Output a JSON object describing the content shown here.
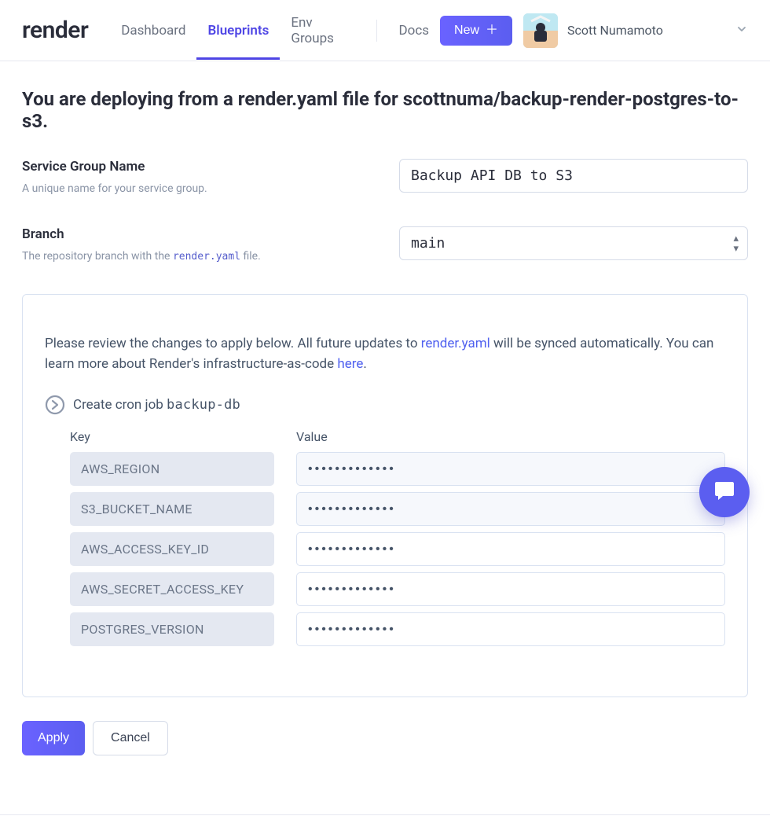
{
  "brand": {
    "name": "render"
  },
  "nav": {
    "tabs": [
      {
        "label": "Dashboard"
      },
      {
        "label": "Blueprints",
        "active": true
      },
      {
        "label": "Env Groups"
      }
    ],
    "docs_label": "Docs",
    "new_button_label": "New"
  },
  "user": {
    "name": "Scott Numamoto"
  },
  "page": {
    "title": "You are deploying from a render.yaml file for scottnuma/backup-render-postgres-to-s3."
  },
  "form": {
    "service_group": {
      "label": "Service Group Name",
      "help": "A unique name for your service group.",
      "value": "Backup API DB to S3"
    },
    "branch": {
      "label": "Branch",
      "help_pre": "The repository branch with the ",
      "help_code": "render.yaml",
      "help_post": " file.",
      "value": "main"
    }
  },
  "panel": {
    "text_part1": "Please review the changes to apply below. All future updates to ",
    "link1": "render.yaml",
    "text_part2": " will be synced automatically. You can learn more about Render's infrastructure-as-code ",
    "link2": "here",
    "text_part3": ".",
    "cron": {
      "prefix": "Create cron job ",
      "name": "backup-db"
    },
    "headers": {
      "key": "Key",
      "value": "Value"
    },
    "env_rows": [
      {
        "key": "AWS_REGION",
        "value": "•••••••••••••"
      },
      {
        "key": "S3_BUCKET_NAME",
        "value": "•••••••••••••"
      },
      {
        "key": "AWS_ACCESS_KEY_ID",
        "value": "•••••••••••••"
      },
      {
        "key": "AWS_SECRET_ACCESS_KEY",
        "value": "•••••••••••••"
      },
      {
        "key": "POSTGRES_VERSION",
        "value": "•••••••••••••"
      }
    ]
  },
  "actions": {
    "apply": "Apply",
    "cancel": "Cancel"
  }
}
